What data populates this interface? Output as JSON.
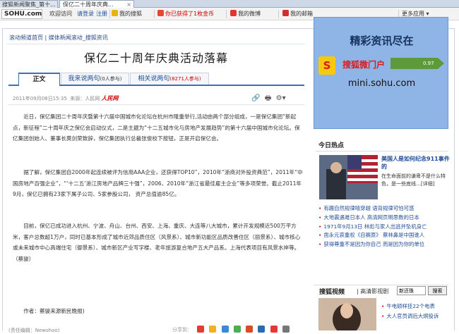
{
  "browser": {
    "tabs": [
      {
        "label": "搜狐新闻聚焦_第十..."
      },
      {
        "label": "保亿二十周年庆典..."
      }
    ]
  },
  "topbar": {
    "logo": "SOHU.com",
    "welcome": "欢迎访问",
    "login": "请登录",
    "register": "注册",
    "links": [
      {
        "label": "我的搜狐",
        "icon": "sohu-fox-icon"
      },
      {
        "label": "你已获得了1枚金币",
        "icon": "gift-icon"
      },
      {
        "label": "我的微博",
        "icon": "weibo-icon"
      },
      {
        "label": "我的邮箱",
        "icon": "mail-icon"
      }
    ],
    "more": "更多应用",
    "accent": "#cc0000"
  },
  "breadcrumb": "滚动频道首页 | 媒体新闻滚动_搜狐资讯",
  "article": {
    "title": "保亿二十周年庆典活动落幕",
    "tabs": [
      {
        "label": "正文"
      },
      {
        "label": "我来说两句",
        "count": "(0人参与)"
      },
      {
        "label": "相关说两句",
        "count": "(8271人参与)"
      }
    ],
    "date": "2011年09月08日15:35",
    "source_label": "来源：人民网",
    "source_logo": "人民网",
    "paragraphs": [
      "近日，保亿集团二十周年庆暨第十六届中国城市化论坛在杭州市隆重举行,活动由两个部分组成，一是保亿集团“新起点，新征程”二十周年庆之保亿会启动仪式，二是主题为“十二五城市化与房地产发展趋势”的第十六届中国城市化论坛。保亿集团创始人、董事长莫剑荣致辞，保亿集团执行总裁张俊校下按钮，正是开启保亿会。",
      "据了解，保亿集团自2000年起连续被评为信用AAA企业，还获得TOP10”，2010年“浙商对外投资典范”，2011年“中国房地产百强企业”，“‘十二五’浙江房地产品牌三十强”，2006、2010年“浙江省最佳雇主企业”等多项荣誉。截止2011年9月，保亿已拥有23家下属子公司、5家参股公司， 资产总值逾85亿。",
      "目前，保亿已成功进入杭州、宁波、舟山、台州、西安、上海、重庆、大连等八大城市，累计开发规模近500万平方米，客户总数超1万户，同时已基本形成了城市近郊品质住区（风景系）、城市新功能区品质改善住区（丽景系）、城市核心或未来城市中心高端住宅（御景系）、城市新区产业写字楼、老年旅游复合地产五大产品系。上海代表项目有风景水岸等。（蔡骏）"
    ],
    "author": "作者：蔡骏来源新民晚报)",
    "editor": "(责任编辑：Newshoo)",
    "share_label": "分享到："
  },
  "ad": {
    "headline": "精彩资讯尽在",
    "brand": "搜狐微门户",
    "arrow_text": "0.97",
    "url": "mini.sohu.com"
  },
  "hot": {
    "heading": "今日热点",
    "feature_title": "美国人是如何纪念911事件的",
    "feature_desc": "在生命面前的谦卑不是什么特色，是一些底线…[详细]",
    "items": [
      "有趣自然规律嘻穿越 语背规律可怕可惑",
      "大地震遇难日本人 高清网页明思数的日本",
      "1971年9月13日 林彪与家人出逃并坠机身亡",
      "凿永元哀重权《自赛原》 蔡林鼻是中国谁人",
      "获得尊重不是因为你自己 而是因为你的单位"
    ]
  },
  "video": {
    "label": "搜狐视频",
    "sub": "| 高清影视剧",
    "search_value": "新还珠",
    "search_button": "搜索",
    "items": [
      "牛电硕样挂22个电表",
      "大人官员调后大炯投诉"
    ]
  }
}
